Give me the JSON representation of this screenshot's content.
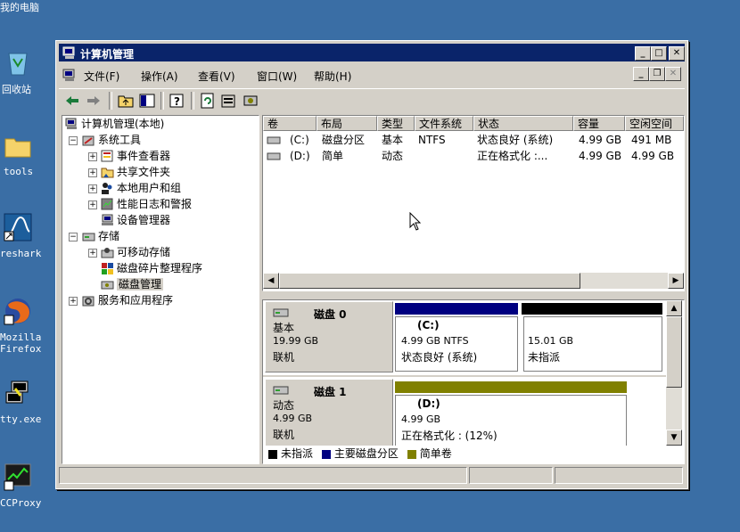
{
  "desktop": {
    "icons": [
      {
        "label": "我的电脑"
      },
      {
        "label": "回收站"
      },
      {
        "label": "tools"
      },
      {
        "label": "reshark"
      },
      {
        "label": "Mozilla"
      },
      {
        "label": "Firefox"
      },
      {
        "label": "tty.exe"
      },
      {
        "label": "CCProxy"
      }
    ]
  },
  "window": {
    "title": "计算机管理",
    "menus": [
      "文件(F)",
      "操作(A)",
      "查看(V)",
      "窗口(W)",
      "帮助(H)"
    ]
  },
  "tree": {
    "root": "计算机管理(本地)",
    "items": [
      "系统工具",
      "事件查看器",
      "共享文件夹",
      "本地用户和组",
      "性能日志和警报",
      "设备管理器",
      "存储",
      "可移动存储",
      "磁盘碎片整理程序",
      "磁盘管理",
      "服务和应用程序"
    ]
  },
  "volumes": {
    "columns": [
      "卷",
      "布局",
      "类型",
      "文件系统",
      "状态",
      "容量",
      "空闲空间"
    ],
    "rows": [
      [
        "(C:)",
        "磁盘分区",
        "基本",
        "NTFS",
        "状态良好 (系统)",
        "4.99 GB",
        "491 MB"
      ],
      [
        "(D:)",
        "简单",
        "动态",
        "",
        "正在格式化 :...",
        "4.99 GB",
        "4.99 GB"
      ]
    ]
  },
  "disks": [
    {
      "name": "磁盘 0",
      "type": "基本",
      "size": "19.99 GB",
      "status": "联机",
      "partitions": [
        {
          "label": "(C:)",
          "line1": "4.99 GB NTFS",
          "line2": "状态良好 (系统)"
        },
        {
          "label": "",
          "line1": "15.01 GB",
          "line2": "未指派"
        }
      ]
    },
    {
      "name": "磁盘 1",
      "type": "动态",
      "size": "4.99 GB",
      "status": "联机",
      "partitions": [
        {
          "label": "(D:)",
          "line1": "4.99 GB",
          "line2": "正在格式化 : (12%)"
        }
      ]
    }
  ],
  "legend": [
    "未指派",
    "主要磁盘分区",
    "简单卷"
  ],
  "colors": {
    "desktop": "#3a6ea5",
    "titlebar": "#0a246a",
    "primary_partition": "#000080",
    "unallocated": "#000000",
    "simple_volume": "#808000"
  }
}
